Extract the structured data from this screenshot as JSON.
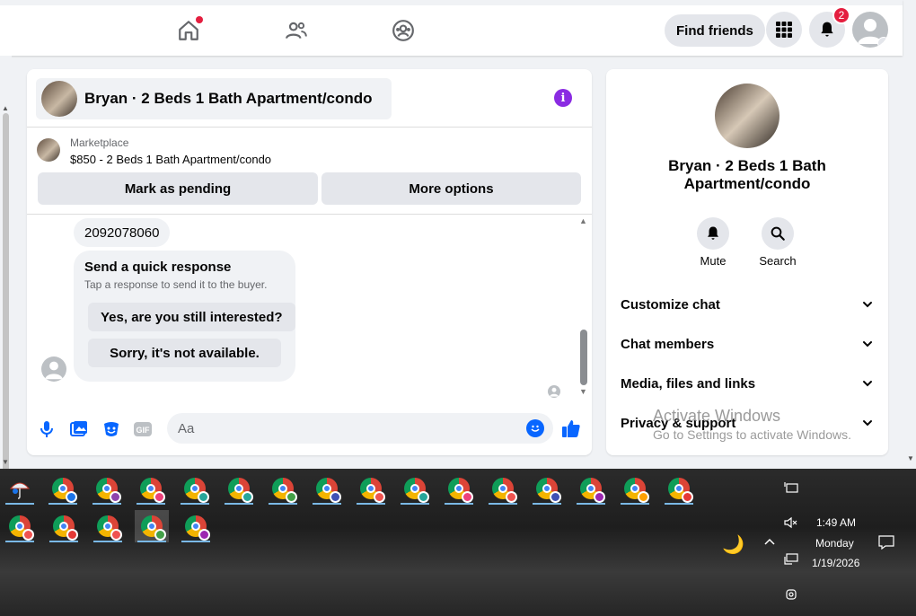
{
  "topbar": {
    "find_friends": "Find friends",
    "notification_count": "2"
  },
  "chat": {
    "header_title": "Bryan · 2 Beds 1 Bath Apartment/condo",
    "marketplace_label": "Marketplace",
    "listing": "$850 - 2 Beds 1 Bath Apartment/condo",
    "mark_pending": "Mark as pending",
    "more_options": "More options",
    "phone_message": "2092078060",
    "quick_response": {
      "title": "Send a quick response",
      "subtitle": "Tap a response to send it to the buyer.",
      "options": [
        "Yes, are you still interested?",
        "Sorry, it's not available."
      ]
    },
    "composer_placeholder": "Aa"
  },
  "details": {
    "name": "Bryan · 2 Beds 1 Bath Apartment/condo",
    "mute": "Mute",
    "search": "Search",
    "sections": [
      "Customize chat",
      "Chat members",
      "Media, files and links",
      "Privacy & support"
    ]
  },
  "watermark": {
    "line1": "Activate Windows",
    "line2": "Go to Settings to activate Windows."
  },
  "taskbar": {
    "time": "1:49 AM",
    "day": "Monday",
    "date": "1/19/2026",
    "profile_colors_row1": [
      "#1a73e8",
      "#8e44ad",
      "#ec407a",
      "#26a69a",
      "#26a69a",
      "#43a047",
      "#3f51b5",
      "#ef5350",
      "#26a69a",
      "#ec407a",
      "#ef5350",
      "#3f51b5",
      "#9c27b0",
      "#ffa000",
      "#e53935"
    ],
    "profile_colors_row2": [
      "#ef5350",
      "#e53935",
      "#ef5350",
      "#43a047",
      "#9c27b0"
    ]
  }
}
